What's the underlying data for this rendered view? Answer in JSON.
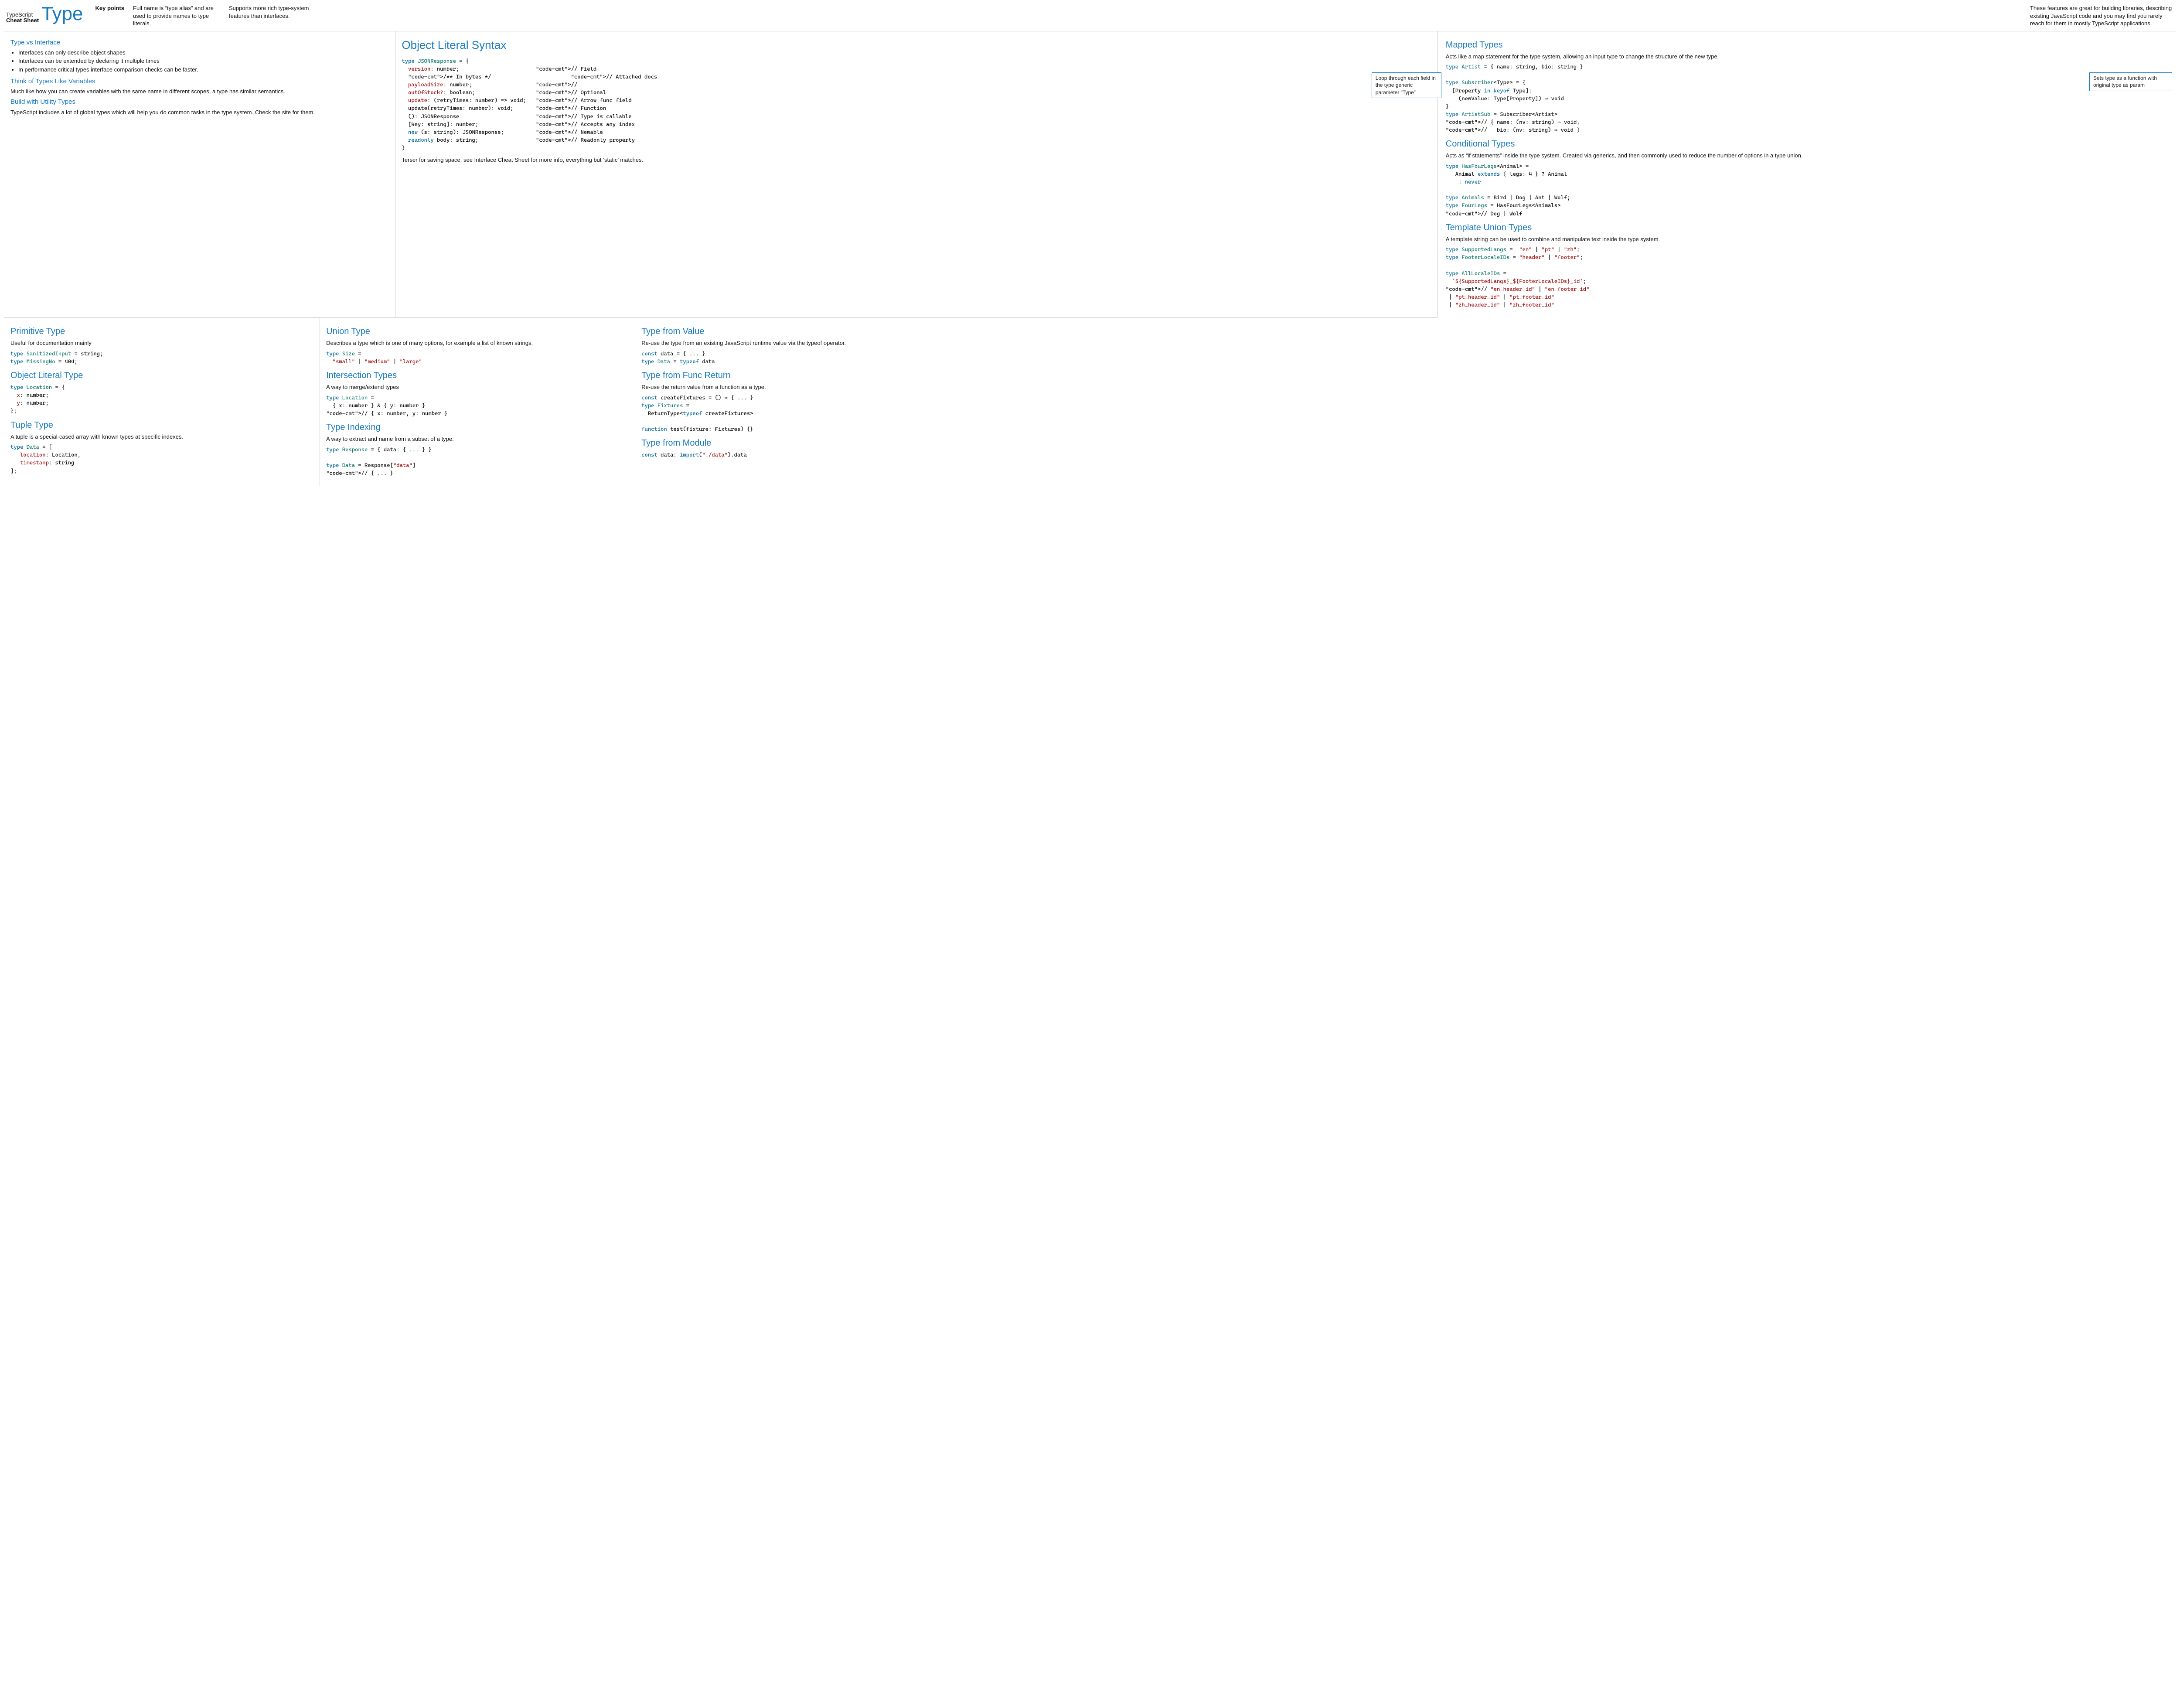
{
  "logo": {
    "line1": "TypeScript",
    "line2": "Cheat Sheet"
  },
  "title": "Type",
  "key_points": {
    "label": "Key points",
    "p1": "Full name is “type alias” and are used to provide names to type literals",
    "p2": "Supports more rich type-system features than interfaces.",
    "p3": "These features are great for building libraries, describing existing JavaScript code and you may find you rarely reach for them in mostly TypeScript applications."
  },
  "left": {
    "tvi_title": "Type vs Interface",
    "tvi_items": [
      "Interfaces can only describe object shapes",
      "Interfaces can be extended by declaring it multiple times",
      "In performance critical types interface comparison checks can be faster."
    ],
    "vars_title": "Think of Types Like Variables",
    "vars_body": "Much like how you can create variables with the same name in different scopes, a type has similar semantics.",
    "util_title": "Build with Utility Types",
    "util_body": "TypeScript includes a lot of global types which will help you do common tasks in the type system. Check the site for them."
  },
  "object_literal": {
    "title": "Object Literal Syntax",
    "code": "type JSONResponse = {\n  version: number;                        // Field\n  /** In bytes */                         // Attached docs\n  payloadSize: number;                    //\n  outOfStock?: boolean;                   // Optional\n  update: (retryTimes: number) => void;   // Arrow func field\n  update(retryTimes: number): void;       // Function\n  (): JSONResponse                        // Type is callable\n  [key: string]: number;                  // Accepts any index\n  new (s: string): JSONResponse;          // Newable\n  readonly body: string;                  // Readonly property\n}",
    "footer": "Terser for saving space, see Interface Cheat Sheet for more info, everything but ‘static’ matches."
  },
  "mapped": {
    "title": "Mapped Types",
    "body": "Acts like a map statement for the type system, allowing an input type to change the structure of the new type.",
    "code": "type Artist = { name: string, bio: string }\n\ntype Subscriber<Type> = {\n  [Property in keyof Type]:\n    (newValue: Type[Property]) ⇒ void\n}\ntype ArtistSub = Subscriber<Artist>\n// { name: (nv: string) ⇒ void,\n//   bio: (nv: string) ⇒ void }",
    "callout1": "Loop through each field in the type generic parameter “Type”",
    "callout2": "Sets type as a function with original type as param"
  },
  "conditional": {
    "title": "Conditional Types",
    "body": "Acts as “if statements” inside the type system. Created via generics, and then commonly used to reduce the number of options in a type union.",
    "code": "type HasFourLegs<Animal> =\n   Animal extends { legs: 4 } ? Animal\n    : never\n\ntype Animals = Bird | Dog | Ant | Wolf;\ntype FourLegs = HasFourLegs<Animals>\n// Dog | Wolf"
  },
  "template": {
    "title": "Template Union Types",
    "body": "A template string can be used to combine and manipulate text inside the type system.",
    "code": "type SupportedLangs =  \"en\" | \"pt\" | \"zh\";\ntype FooterLocaleIDs = \"header\" | \"footer\";\n\ntype AllLocaleIDs =\n  `${SupportedLangs}_${FooterLocaleIDs}_id`;\n// \"en_header_id\" | \"en_footer_id\"\n | \"pt_header_id\" | \"pt_footer_id\"\n | \"zh_header_id\" | \"zh_footer_id\""
  },
  "primitive": {
    "title": "Primitive Type",
    "body": "Useful for documentation mainly",
    "code": "type SanitizedInput = string;\ntype MissingNo = 404;"
  },
  "objlit": {
    "title": "Object Literal Type",
    "code": "type Location = {\n  x: number;\n  y: number;\n};"
  },
  "tuple": {
    "title": "Tuple Type",
    "body": "A tuple is a special-cased array with known types at specific indexes.",
    "code": "type Data = [\n   location: Location,\n   timestamp: string\n];"
  },
  "union": {
    "title": "Union Type",
    "body": "Describes a type which is one of many options, for example a list of known strings.",
    "code": "type Size =\n  \"small\" | \"medium\" | \"large\""
  },
  "intersection": {
    "title": "Intersection Types",
    "body": "A way to merge/extend types",
    "code": "type Location =\n  { x: number } & { y: number }\n// { x: number, y: number }"
  },
  "indexing": {
    "title": "Type Indexing",
    "body": "A way to extract and name from a subset of a type.",
    "code": "type Response = { data: { ... } }\n\ntype Data = Response[\"data\"]\n// { ... }"
  },
  "fromvalue": {
    "title": "Type from Value",
    "body": "Re-use the type from an existing JavaScript runtime value via the typeof operator.",
    "code": "const data = { ... }\ntype Data = typeof data"
  },
  "fromfunc": {
    "title": "Type from Func Return",
    "body": "Re-use the return value from a function as a type.",
    "code": "const createFixtures = () ⇒ { ... }\ntype Fixtures =\n  ReturnType<typeof createFixtures>\n\nfunction test(fixture: Fixtures) {}"
  },
  "frommodule": {
    "title": "Type from Module",
    "code": "const data: import(\"./data\").data"
  }
}
